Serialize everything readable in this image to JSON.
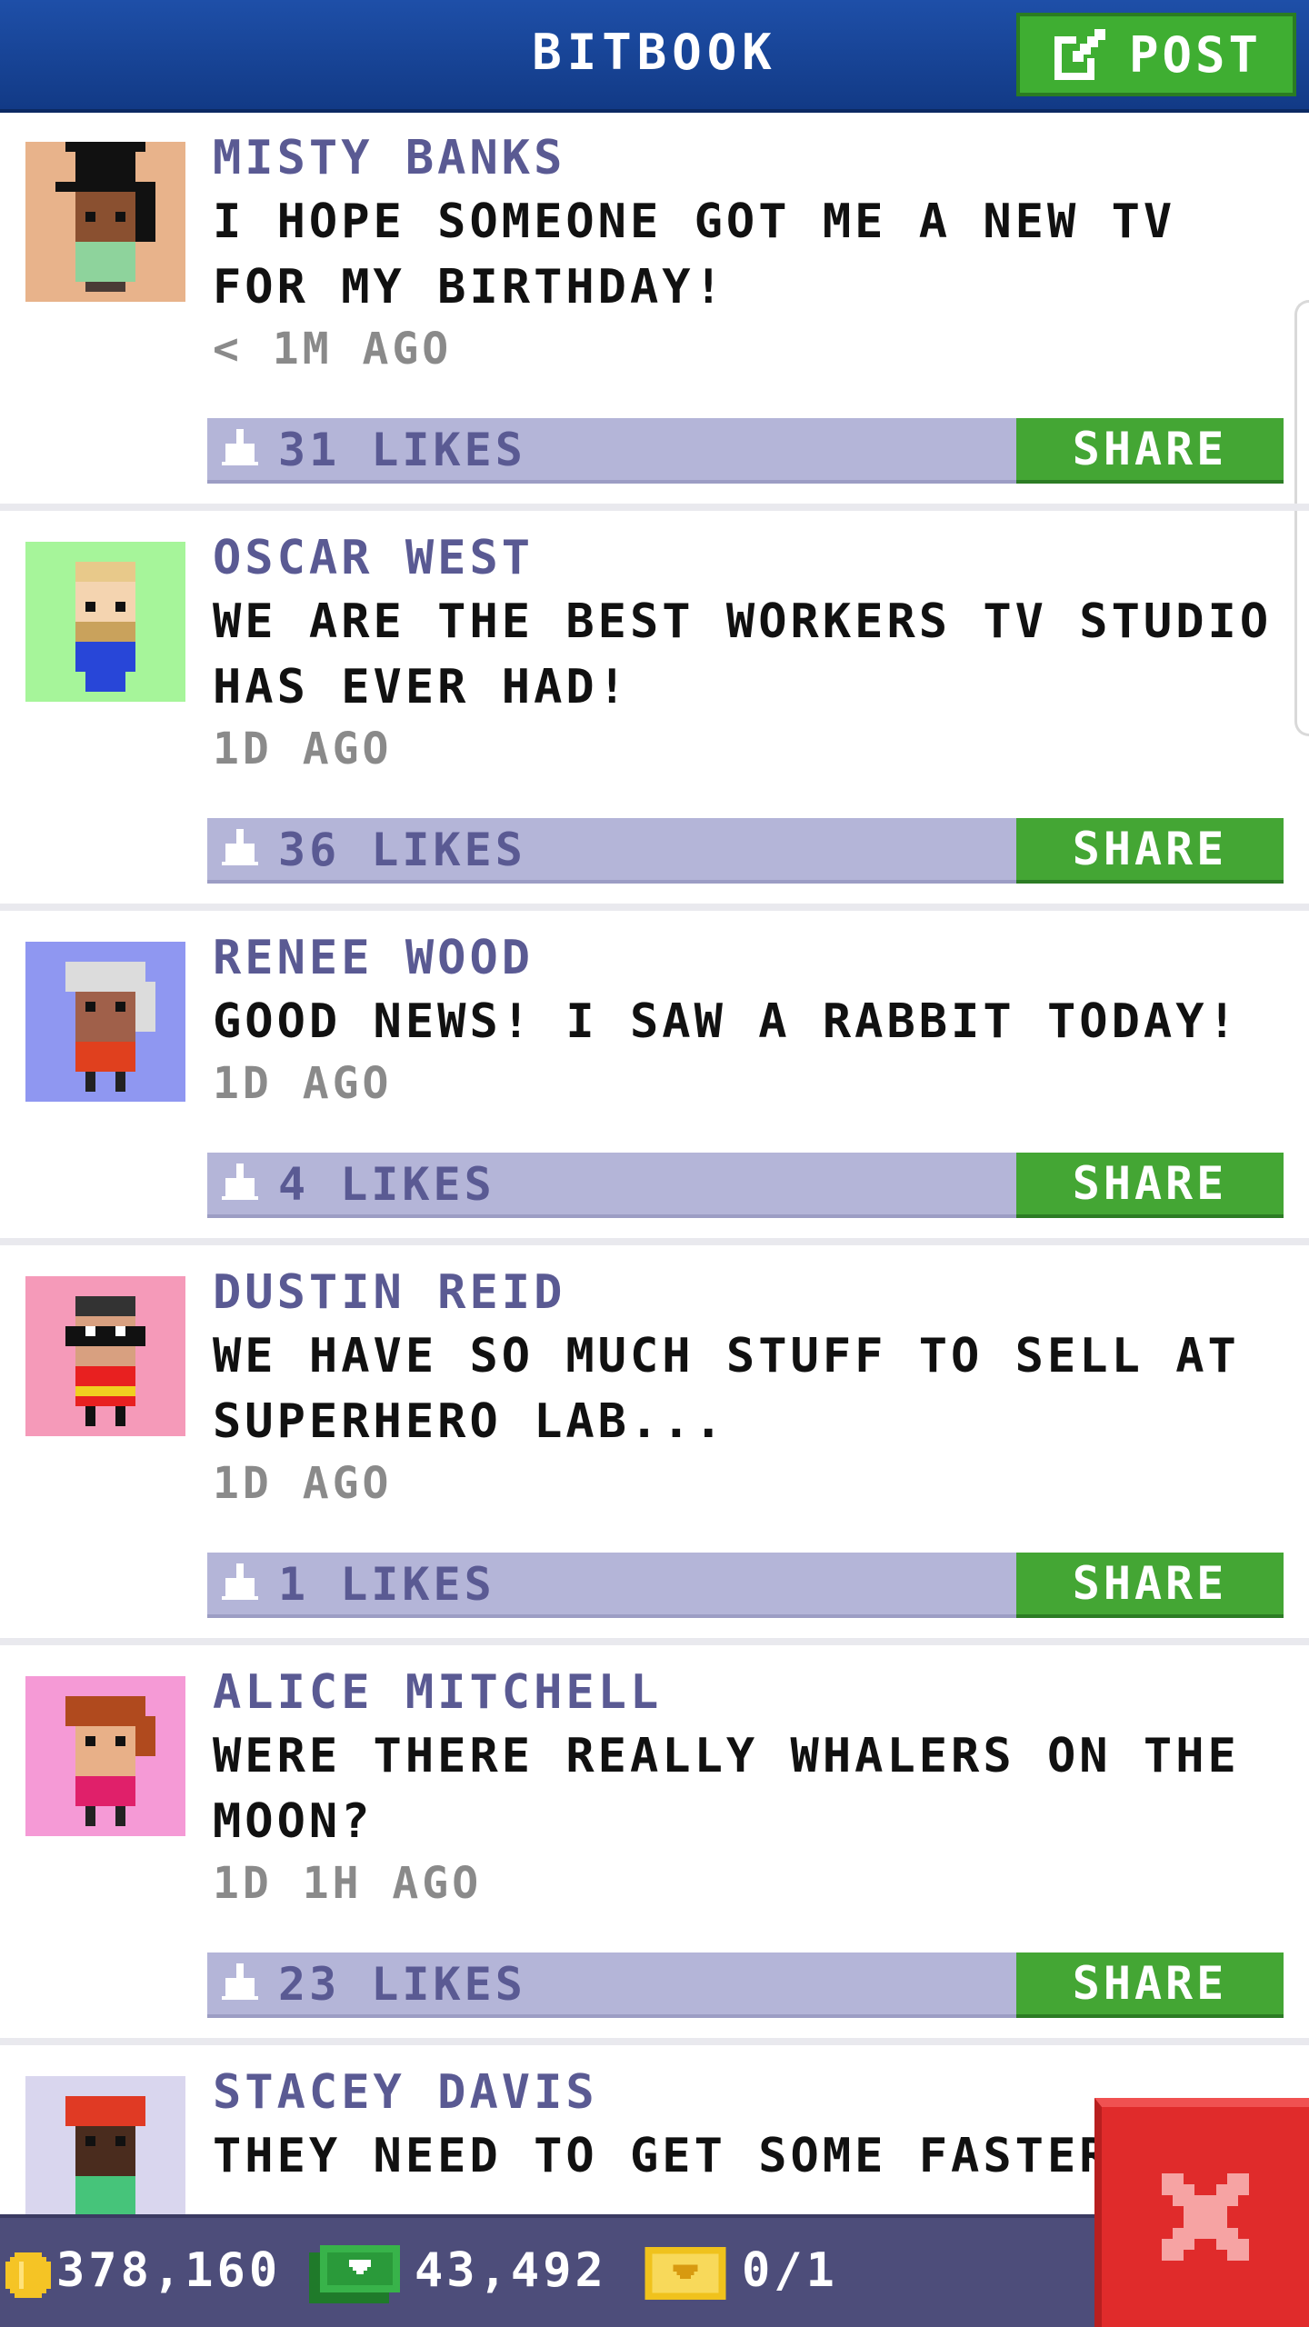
{
  "header": {
    "title": "BITBOOK",
    "post_label": "POST"
  },
  "posts": [
    {
      "name": "MISTY BANKS",
      "message": "I HOPE SOMEONE GOT ME A NEW TV FOR MY BIRTHDAY!",
      "time": "< 1M AGO",
      "likes": "31 LIKES",
      "share": "SHARE",
      "avatar_bg": "#e8b38b"
    },
    {
      "name": "OSCAR WEST",
      "message": "WE ARE THE BEST WORKERS TV STUDIO HAS EVER HAD!",
      "time": "1D AGO",
      "likes": "36 LIKES",
      "share": "SHARE",
      "avatar_bg": "#a6f59a"
    },
    {
      "name": "RENEE WOOD",
      "message": "GOOD NEWS! I SAW A RABBIT TODAY!",
      "time": "1D AGO",
      "likes": "4 LIKES",
      "share": "SHARE",
      "avatar_bg": "#8f97f1"
    },
    {
      "name": "DUSTIN REID",
      "message": "WE HAVE SO MUCH STUFF TO SELL AT SUPERHERO LAB...",
      "time": "1D AGO",
      "likes": "1 LIKES",
      "share": "SHARE",
      "avatar_bg": "#f59ab9"
    },
    {
      "name": "ALICE MITCHELL",
      "message": "WERE THERE REALLY WHALERS ON THE MOON?",
      "time": "1D 1H AGO",
      "likes": "23 LIKES",
      "share": "SHARE",
      "avatar_bg": "#f59ad6"
    },
    {
      "name": "STACEY DAVIS",
      "message": "THEY NEED TO GET SOME FASTER",
      "avatar_bg": "#d9d6ee"
    }
  ],
  "bottombar": {
    "coins": "378,160",
    "bux": "43,492",
    "tickets": "0/1"
  },
  "colors": {
    "header": "#1e4fa8",
    "accent_green": "#44a634",
    "like_bar": "#b4b5d8",
    "name_purple": "#5a5a93",
    "close_red": "#e02b2b"
  },
  "icons": {
    "post": "edit-icon",
    "like": "thumb-up-icon",
    "coin": "coin-icon",
    "cash": "cash-icon",
    "ticket": "ticket-icon",
    "close": "close-icon"
  }
}
